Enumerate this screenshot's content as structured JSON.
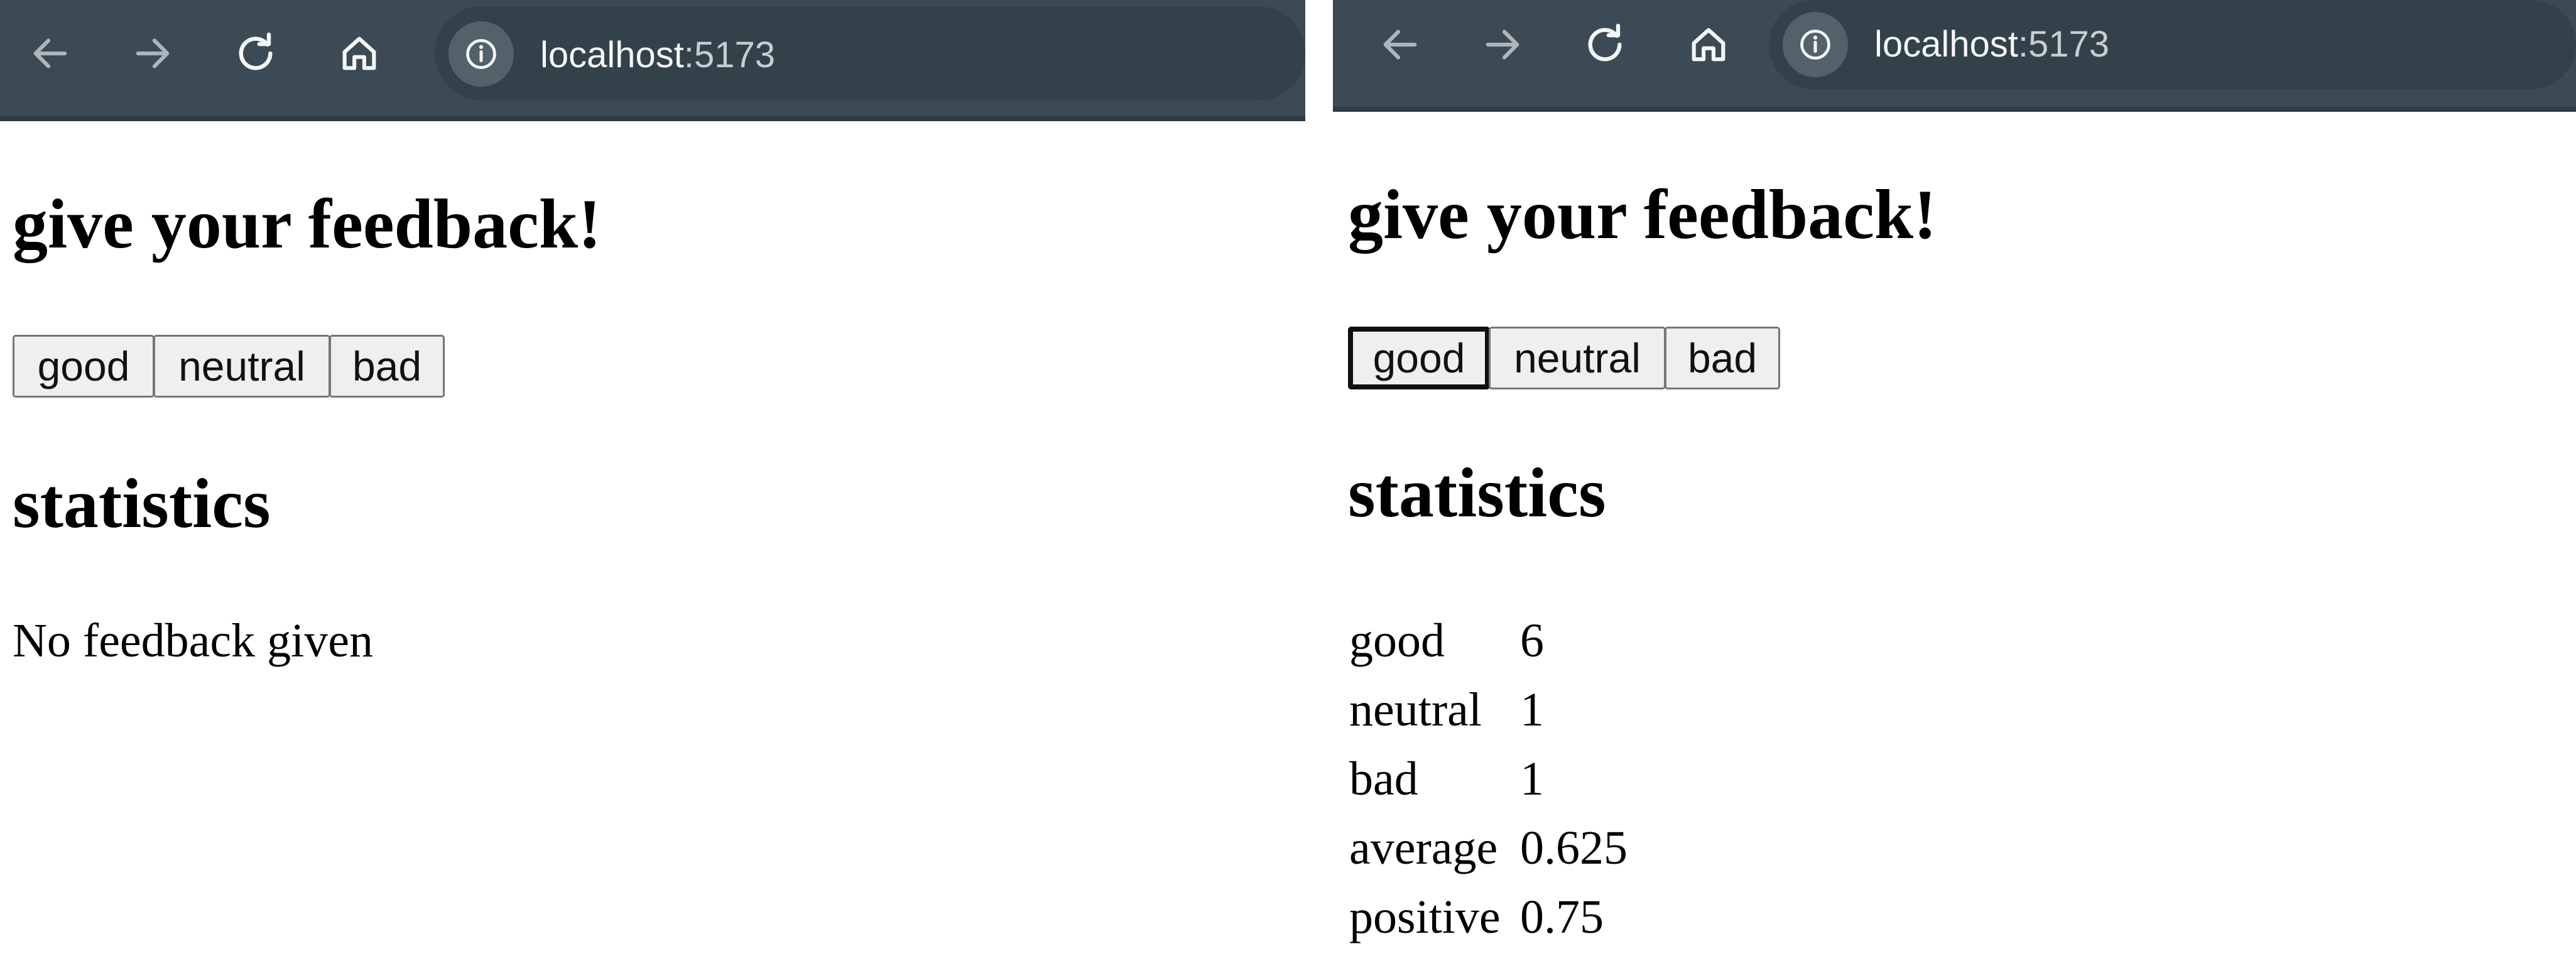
{
  "colors": {
    "toolbar": "#3b4a54",
    "toolbar_border": "#2f3b43",
    "address_bar": "#33414a",
    "site_info_badge": "#52616a",
    "page_background": "#ffffff",
    "text": "#000000",
    "button_background": "#efefef",
    "button_border": "#767676"
  },
  "screens": [
    {
      "browser": {
        "url_host": "localhost",
        "url_port": ":5173",
        "icons": [
          "arrow-left-icon",
          "arrow-right-icon",
          "reload-icon",
          "home-icon",
          "info-icon"
        ]
      },
      "app": {
        "feedback_heading": "give your feedback!",
        "buttons": [
          "good",
          "neutral",
          "bad"
        ],
        "statistics_heading": "statistics",
        "empty_message": "No feedback given"
      }
    },
    {
      "browser": {
        "url_host": "localhost",
        "url_port": ":5173",
        "icons": [
          "arrow-left-icon",
          "arrow-right-icon",
          "reload-icon",
          "home-icon",
          "info-icon"
        ]
      },
      "app": {
        "feedback_heading": "give your feedback!",
        "buttons": [
          "good",
          "neutral",
          "bad"
        ],
        "focused_button": "good",
        "statistics_heading": "statistics",
        "statistics": [
          {
            "label": "good",
            "value": "6"
          },
          {
            "label": "neutral",
            "value": "1"
          },
          {
            "label": "bad",
            "value": "1"
          },
          {
            "label": "average",
            "value": "0.625"
          },
          {
            "label": "positive",
            "value": "0.75"
          }
        ]
      }
    }
  ]
}
